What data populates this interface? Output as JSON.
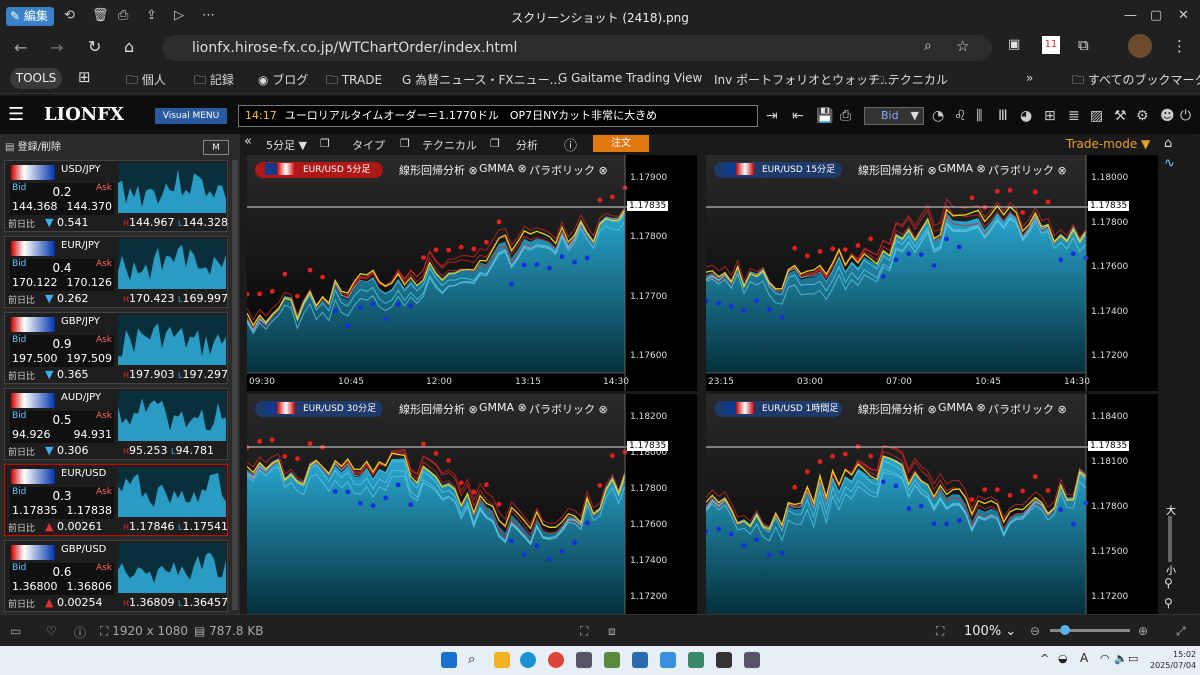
{
  "viewer": {
    "edit": "編集",
    "title": "スクリーンショット (2418).png",
    "size": "1920 x 1080",
    "filesize": "787.8 KB",
    "zoom": "100%"
  },
  "browser": {
    "url": "lionfx.hirose-fx.co.jp/WTChartOrder/index.html"
  },
  "bookmarks": {
    "tools": "TOOLS",
    "items": [
      "個人",
      "記録",
      "ブログ",
      "TRADE",
      "為替ニュース・FXニュー...",
      "Gaitame Trading View",
      "ポートフォリオとウォッチ...",
      "テクニカル"
    ],
    "all": "すべてのブックマーク",
    "ext_badge": "11"
  },
  "app": {
    "logo": "LIONFX",
    "menu": "Visual MENU",
    "ticker_time": "14:17",
    "ticker_text": "ユーロリアルタイムオーダー＝1.1770ドル　OP7日NYカット非常に大きめ",
    "bid_select": "Bid",
    "trade_mode": "Trade-mode ▼"
  },
  "left_panel": {
    "header": "登録/削除",
    "btn": "M",
    "prev_label": "前日比",
    "pairs": [
      {
        "name": "USD/JPY",
        "spread": "0.2",
        "bid": "144.368",
        "ask": "144.370",
        "change": "0.541",
        "dir": "down",
        "high": "144.967",
        "low": "144.328"
      },
      {
        "name": "EUR/JPY",
        "spread": "0.4",
        "bid": "170.122",
        "ask": "170.126",
        "change": "0.262",
        "dir": "down",
        "high": "170.423",
        "low": "169.997"
      },
      {
        "name": "GBP/JPY",
        "spread": "0.9",
        "bid": "197.500",
        "ask": "197.509",
        "change": "0.365",
        "dir": "down",
        "high": "197.903",
        "low": "197.297"
      },
      {
        "name": "AUD/JPY",
        "spread": "0.5",
        "bid": "94.926",
        "ask": "94.931",
        "change": "0.306",
        "dir": "down",
        "high": "95.253",
        "low": "94.781"
      },
      {
        "name": "EUR/USD",
        "spread": "0.3",
        "bid": "1.17835",
        "ask": "1.17838",
        "change": "0.00261",
        "dir": "up",
        "high": "1.17846",
        "low": "1.17541"
      },
      {
        "name": "GBP/USD",
        "spread": "0.6",
        "bid": "1.36800",
        "ask": "1.36806",
        "change": "0.00254",
        "dir": "up",
        "high": "1.36809",
        "low": "1.36457"
      }
    ],
    "bid_label": "Bid",
    "ask_label": "Ask"
  },
  "chart_toolbar": {
    "period": "5分足 ▼",
    "type": "タイプ",
    "technical": "テクニカル",
    "analysis": "分析",
    "order": "注文"
  },
  "indicators": [
    "線形回帰分析",
    "GMMA",
    "パラボリック"
  ],
  "charts": [
    {
      "tag": "EUR/USD 5分足",
      "axis": [
        "1.17900",
        "1.17800",
        "1.17700",
        "1.17600"
      ],
      "price": "1.17835",
      "x": [
        "09:30",
        "10:45",
        "12:00",
        "13:15",
        "14:30"
      ]
    },
    {
      "tag": "EUR/USD 15分足",
      "axis": [
        "1.18000",
        "1.17800",
        "1.17600",
        "1.17400",
        "1.17200"
      ],
      "price": "1.17835",
      "x": [
        "23:15",
        "03:00",
        "07:00",
        "10:45",
        "14:30"
      ]
    },
    {
      "tag": "EUR/USD 30分足",
      "axis": [
        "1.18200",
        "1.18000",
        "1.17800",
        "1.17600",
        "1.17400",
        "1.17200"
      ],
      "price": "1.17835",
      "x": []
    },
    {
      "tag": "EUR/USD 1時間足",
      "axis": [
        "1.18400",
        "1.18100",
        "1.17800",
        "1.17500",
        "1.17200"
      ],
      "price": "1.17835",
      "x": []
    }
  ],
  "right_strip": {
    "big": "大",
    "small": "小"
  },
  "taskbar": {
    "time": "15:02",
    "date": "2025/07/04"
  }
}
